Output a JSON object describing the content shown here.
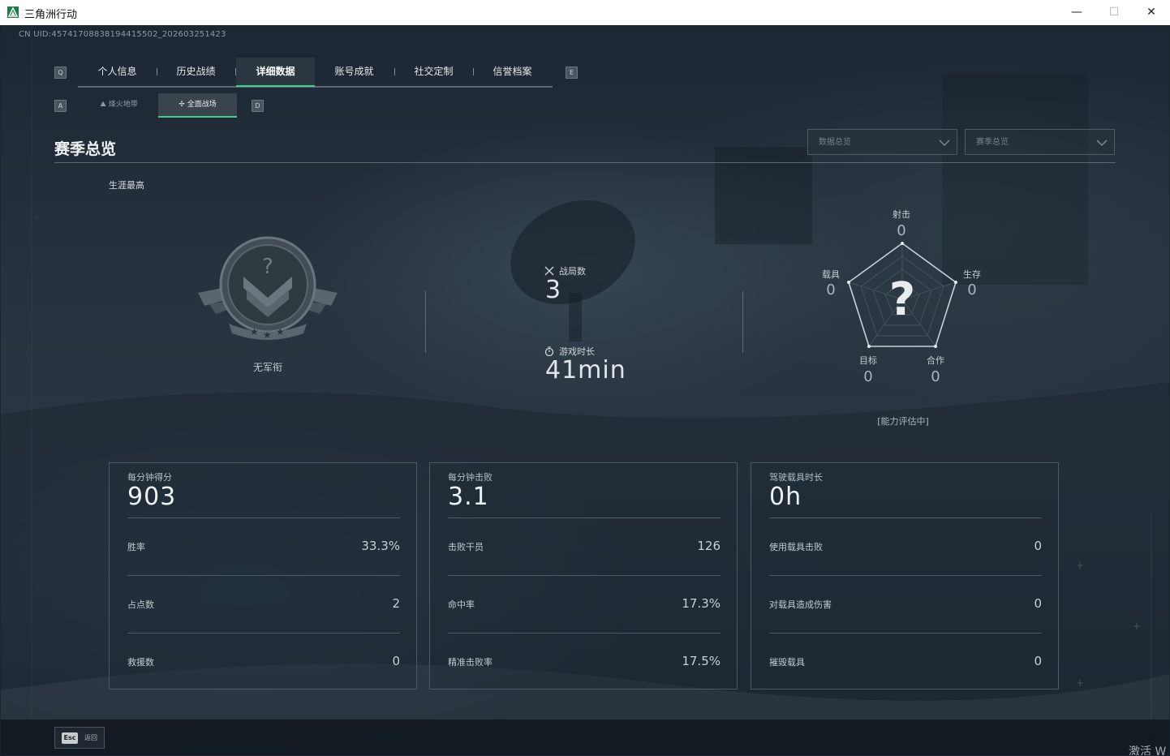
{
  "window": {
    "title": "三角洲行动",
    "min_glyph": "—",
    "max_glyph": "☐",
    "close_glyph": "✕"
  },
  "header": {
    "uid": "CN UID:4574170883819441550​2_202603251423",
    "tab_key_left": "Q",
    "tab_key_right": "E",
    "tabs": [
      {
        "label": "个人信息"
      },
      {
        "label": "历史战绩"
      },
      {
        "label": "详细数据",
        "active": true
      },
      {
        "label": "账号成就"
      },
      {
        "label": "社交定制"
      },
      {
        "label": "信誉档案"
      }
    ],
    "subtab_key_left": "A",
    "subtab_key_right": "D",
    "subtabs": [
      {
        "label": "烽火地带",
        "icon": "mountain-icon"
      },
      {
        "label": "全面战场",
        "icon": "crosshair-icon",
        "active": true
      }
    ]
  },
  "section": {
    "title": "赛季总览",
    "filters": [
      {
        "value": "数据总览"
      },
      {
        "value": "赛季总览"
      }
    ]
  },
  "career": {
    "label": "生涯最高",
    "rank_name": "无军衔",
    "rank_emblem": "unknown-rank-emblem"
  },
  "stats": {
    "matches_label": "战局数",
    "matches_value": "3",
    "playtime_label": "游戏时长",
    "playtime_value": "41min"
  },
  "radar": {
    "center_symbol": "?",
    "axes": [
      {
        "label": "射击",
        "value": "0"
      },
      {
        "label": "生存",
        "value": "0"
      },
      {
        "label": "合作",
        "value": "0"
      },
      {
        "label": "目标",
        "value": "0"
      },
      {
        "label": "载具",
        "value": "0"
      }
    ],
    "status": "[能力评估中]"
  },
  "cards": [
    {
      "label": "每分钟得分",
      "value": "903",
      "rows": [
        {
          "label": "胜率",
          "value": "33.3%"
        },
        {
          "label": "占点数",
          "value": "2"
        },
        {
          "label": "救援数",
          "value": "0"
        }
      ]
    },
    {
      "label": "每分钟击败",
      "value": "3.1",
      "rows": [
        {
          "label": "击败干员",
          "value": "126"
        },
        {
          "label": "命中率",
          "value": "17.3%"
        },
        {
          "label": "精准击败率",
          "value": "17.5%"
        }
      ]
    },
    {
      "label": "驾驶载具时长",
      "value": "0h",
      "rows": [
        {
          "label": "使用载具击败",
          "value": "0"
        },
        {
          "label": "对载具造成伤害",
          "value": "0"
        },
        {
          "label": "摧毁载具",
          "value": "0"
        }
      ]
    }
  ],
  "footer": {
    "esc_key": "Esc",
    "esc_label": "返回",
    "watermark": "激活 W"
  },
  "colors": {
    "accent": "#3ecf8e",
    "background": "#1b2530",
    "border": "#4e5962"
  }
}
